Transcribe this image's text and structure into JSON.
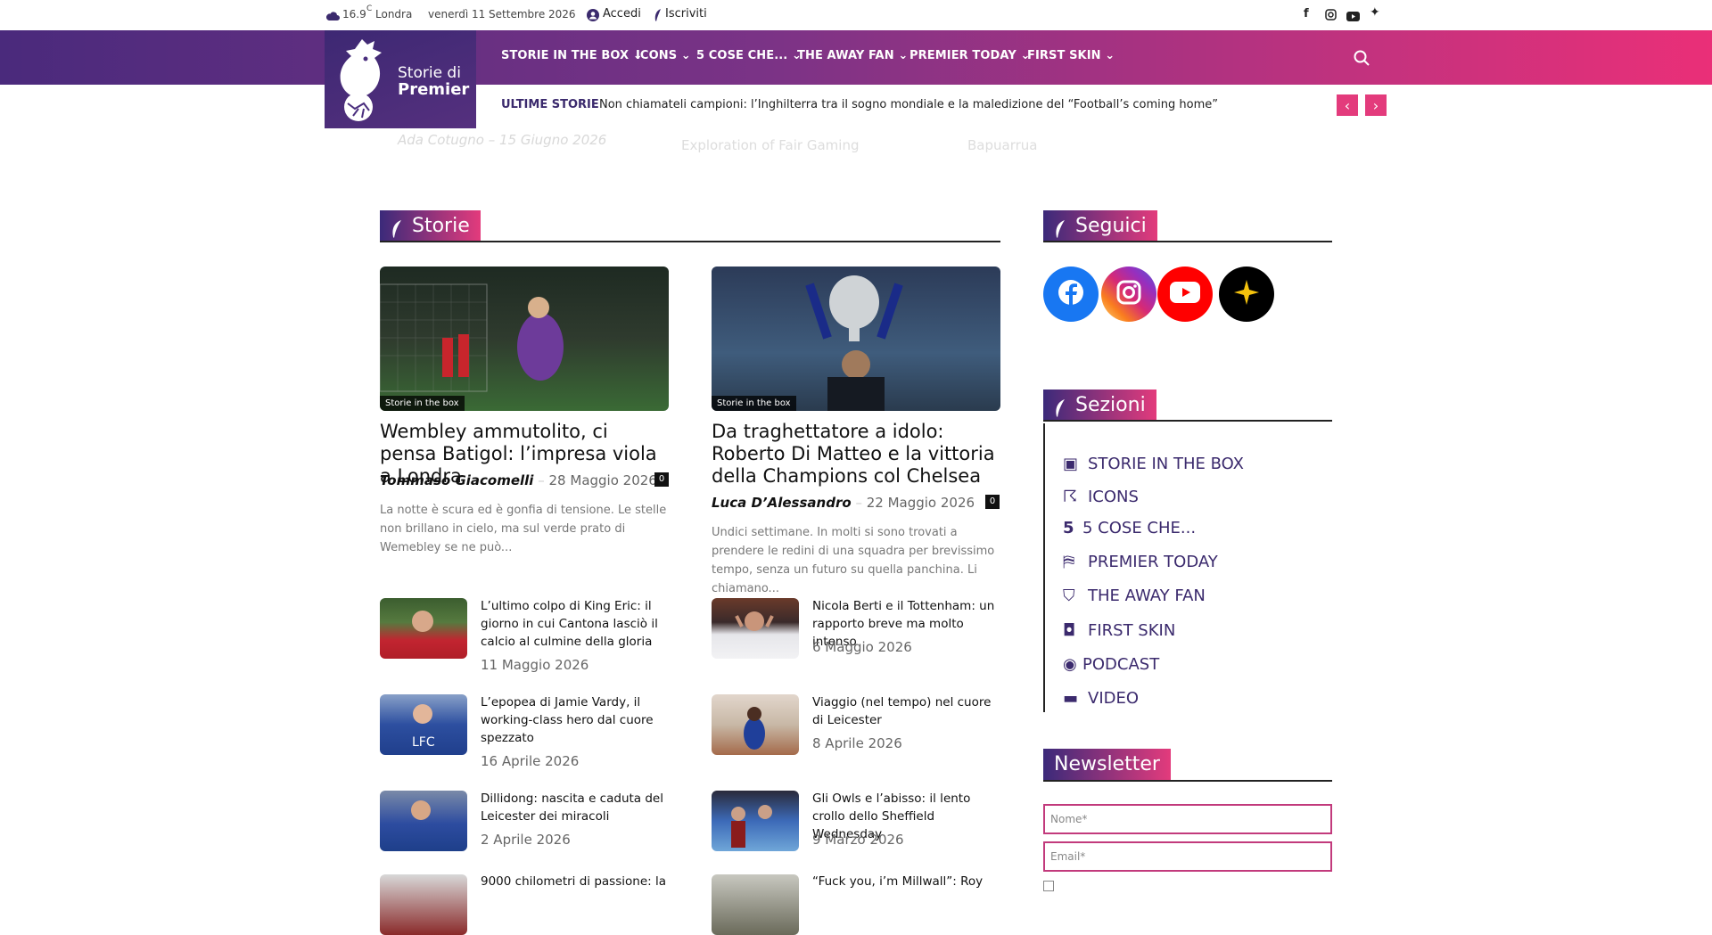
{
  "topbar": {
    "temperature": "16.9",
    "temp_unit": "C",
    "city": "Londra",
    "date": "venerdì 11 Settembre 2026",
    "login": "Accedi",
    "signup": "Iscriviti"
  },
  "nav": {
    "logo_line1": "Storie di",
    "logo_line2": "Premier",
    "items": [
      {
        "label": "STORIE IN THE BOX"
      },
      {
        "label": "ICONS"
      },
      {
        "label": "5 COSE CHE..."
      },
      {
        "label": "THE AWAY FAN"
      },
      {
        "label": "PREMIER TODAY"
      },
      {
        "label": "FIRST SKIN"
      }
    ]
  },
  "ticker": {
    "label": "ULTIME STORIE",
    "headline": "Non chiamateli campioni: l’Inghilterra tra il sogno mondiale e la maledizione del “Football’s coming home”"
  },
  "faded_strip": {
    "byline": "Ada Cotugno – 15 Giugno 2026",
    "item2": "Exploration of Fair Gaming",
    "item3": "Bapuarrua"
  },
  "storie": {
    "section_title": "Storie",
    "featured": [
      {
        "category": "Storie in the box",
        "title": "Wembley ammutolito, ci pensa Batigol: l’impresa viola a Londra",
        "author": "Tommaso Giacomelli",
        "date": "28 Maggio 2026",
        "comments": "0",
        "excerpt": "La notte è scura ed è gonfia di tensione. Le stelle non brillano in cielo, ma sul verde prato di Wemebley se ne può..."
      },
      {
        "category": "Storie in the box",
        "title": "Da traghettatore a idolo: Roberto Di Matteo e la vittoria della Champions col Chelsea",
        "author": "Luca D’Alessandro",
        "date": "22 Maggio 2026",
        "comments": "0",
        "excerpt": "Undici settimane. In molti si sono trovati a prendere le redini di una squadra per brevissimo tempo, senza un futuro su quella panchina. Li chiamano..."
      }
    ],
    "small": [
      {
        "title": "L’ultimo colpo di King Eric: il giorno in cui Cantona lasciò il calcio al culmine della gloria",
        "date": "11 Maggio 2026"
      },
      {
        "title": "Nicola Berti e il Tottenham: un rapporto breve ma molto intenso",
        "date": "6 Maggio 2026"
      },
      {
        "title": "L’epopea di Jamie Vardy, il working-class hero dal cuore spezzato",
        "date": "16 Aprile 2026"
      },
      {
        "title": "Viaggio (nel tempo) nel cuore di Leicester",
        "date": "8 Aprile 2026"
      },
      {
        "title": "Dillidong: nascita e caduta del Leicester dei miracoli",
        "date": "2 Aprile 2026"
      },
      {
        "title": "Gli Owls e l’abisso: il lento crollo dello Sheffield Wednesday",
        "date": "9 Marzo 2026"
      },
      {
        "title": "9000 chilometri di passione: la",
        "date": ""
      },
      {
        "title": "“Fuck you, i’m Millwall”: Roy",
        "date": ""
      }
    ]
  },
  "sidebar": {
    "seguici_title": "Seguici",
    "socials": [
      {
        "icon": "facebook-icon",
        "color": "#1877f2"
      },
      {
        "icon": "instagram-icon",
        "color": "#d6249f"
      },
      {
        "icon": "youtube-icon",
        "color": "#ff0000"
      },
      {
        "icon": "star-icon",
        "color": "#000000"
      }
    ],
    "sezioni_title": "Sezioni",
    "sezioni": [
      {
        "label": "STORIE IN THE BOX",
        "icon": "box-icon"
      },
      {
        "label": "ICONS",
        "icon": "runner-icon"
      },
      {
        "label": "5 COSE CHE...",
        "icon": "five-icon"
      },
      {
        "label": "PREMIER TODAY",
        "icon": "stadium-icon"
      },
      {
        "label": "THE AWAY FAN",
        "icon": "shield-icon"
      },
      {
        "label": "FIRST SKIN",
        "icon": "shirt-icon"
      },
      {
        "label": "PODCAST",
        "icon": "mic-icon"
      },
      {
        "label": "VIDEO",
        "icon": "monitor-icon"
      }
    ],
    "newsletter_title": "Newsletter",
    "name_placeholder": "Nome*",
    "email_placeholder": "Email*"
  },
  "colors": {
    "brand_purple": "#3b2a6d",
    "brand_pink": "#e33b7c"
  }
}
